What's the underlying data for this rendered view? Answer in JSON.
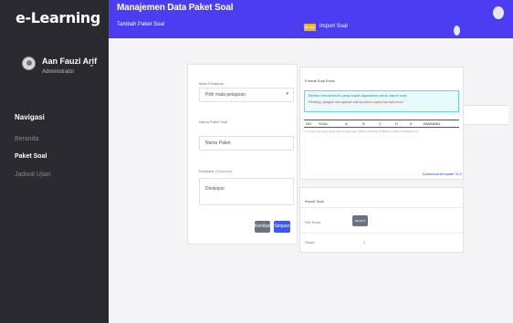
{
  "sidebar": {
    "brand": "e-Learning",
    "user_name": "Aan Fauzi Arif",
    "user_role": "Administrator",
    "nav_title": "Navigasi",
    "items": [
      {
        "label": "Beranda"
      },
      {
        "label": "Paket Soal"
      },
      {
        "label": "Jadwal Ujian"
      }
    ]
  },
  "header": {
    "title": "Manajemen Data Paket Soal",
    "subtitle": "Tambah Paket Soal",
    "badge": "Modal",
    "import_label": "Import Soal"
  },
  "form": {
    "subject_label": "Mata Pelajaran",
    "subject_value": "Pilih mata pelajaran",
    "package_label": "Nama Paket Soal",
    "package_placeholder": "Nama Paket",
    "desc_label": "Deskripsi",
    "desc_optional": "(Opsional)",
    "desc_placeholder": "Deskripsi",
    "back_button": "Kembali",
    "save_button": "Simpan"
  },
  "format_panel": {
    "title": "Format Soal Excel",
    "hint_line1": "Berikut format excel yang dapat digunakan untuk import soal",
    "hint_line2": "Penting: jangan mengubah nama kolom pada format excel",
    "columns": [
      "NO",
      "SOAL",
      "A",
      "B",
      "C",
      "D",
      "E",
      "JAWABAN"
    ],
    "sample_row": "1  Contoh soal yang dapat diisi sesuai materi   Pilihan A   Pilihan B   Pilihan C   Pilihan D   Pilihan E   A",
    "download_link": "Download template XLS"
  },
  "import_panel": {
    "title": "Import Soal",
    "file_label": "File Excel",
    "select_button": "SELECT FILE",
    "sheet_label": "Sheet",
    "sheet_value": "1"
  },
  "colors": {
    "sidebar_bg": "#2a2a30",
    "topbar_bg": "#4a3df2",
    "primary_button": "#3b57f0",
    "secondary_button": "#6b7280",
    "badge": "#f2b31d",
    "hint_bg": "#e8fbfc",
    "hint_border": "#67d4e0",
    "warning_text": "#e53935"
  },
  "icons": {
    "avatar": "user-avatar-icon",
    "caret": "chevron-down-icon",
    "select_caret": "chevron-down-icon"
  }
}
